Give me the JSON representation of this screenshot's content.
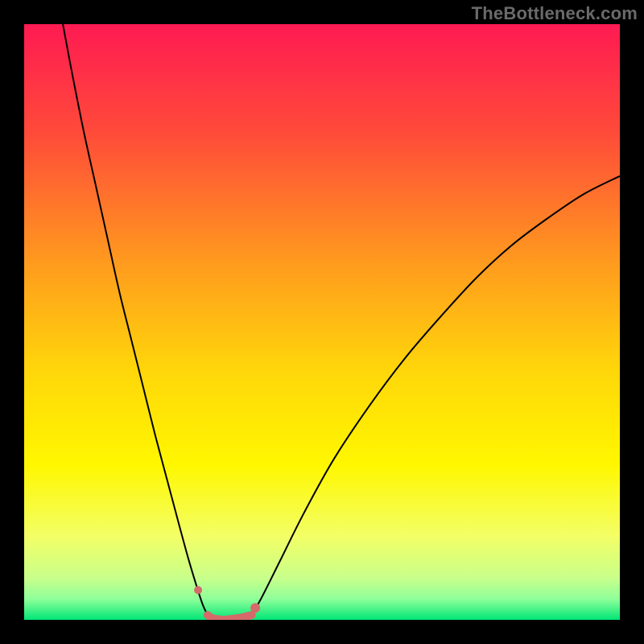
{
  "watermark": "TheBottleneck.com",
  "chart_data": {
    "type": "line",
    "title": "",
    "xlabel": "",
    "ylabel": "",
    "xlim": [
      0,
      100
    ],
    "ylim": [
      0,
      100
    ],
    "grid": false,
    "legend": false,
    "background_gradient": {
      "stops": [
        {
          "offset": 0.0,
          "color": "#ff1a52"
        },
        {
          "offset": 0.18,
          "color": "#ff4a3a"
        },
        {
          "offset": 0.4,
          "color": "#ff9a1e"
        },
        {
          "offset": 0.58,
          "color": "#ffd60a"
        },
        {
          "offset": 0.74,
          "color": "#fff700"
        },
        {
          "offset": 0.86,
          "color": "#f3ff66"
        },
        {
          "offset": 0.93,
          "color": "#c8ff8a"
        },
        {
          "offset": 0.965,
          "color": "#8fff9a"
        },
        {
          "offset": 1.0,
          "color": "#00e676"
        }
      ]
    },
    "series": [
      {
        "name": "curve-left",
        "stroke": "#000000",
        "stroke_width": 2,
        "x": [
          6.5,
          8,
          10,
          12,
          14,
          16,
          18,
          20,
          22,
          24,
          26,
          27.5,
          29,
          30,
          30.8
        ],
        "y": [
          100,
          92,
          82,
          73,
          64,
          55,
          47,
          39,
          31,
          23.5,
          16,
          10.5,
          5.5,
          2.5,
          0.8
        ]
      },
      {
        "name": "curve-right",
        "stroke": "#000000",
        "stroke_width": 2,
        "x": [
          38.2,
          40,
          43,
          47,
          52,
          58,
          64,
          70,
          76,
          82,
          88,
          94,
          100
        ],
        "y": [
          0.8,
          4,
          10,
          18,
          27,
          36,
          44,
          51,
          57.5,
          63,
          67.5,
          71.5,
          74.5
        ]
      },
      {
        "name": "basin-highlight",
        "stroke": "#d46a6a",
        "stroke_width": 10,
        "linecap": "round",
        "x": [
          30.8,
          31.5,
          32.5,
          33.5,
          34.5,
          36,
          37,
          38.2
        ],
        "y": [
          0.8,
          0.3,
          0.1,
          0.0,
          0.1,
          0.3,
          0.5,
          0.8
        ]
      }
    ],
    "markers": [
      {
        "name": "dot-left",
        "x": 29.2,
        "y": 5.0,
        "r": 5,
        "fill": "#d46a6a"
      },
      {
        "name": "dot-right",
        "x": 38.8,
        "y": 2.0,
        "r": 6,
        "fill": "#d46a6a"
      }
    ]
  }
}
